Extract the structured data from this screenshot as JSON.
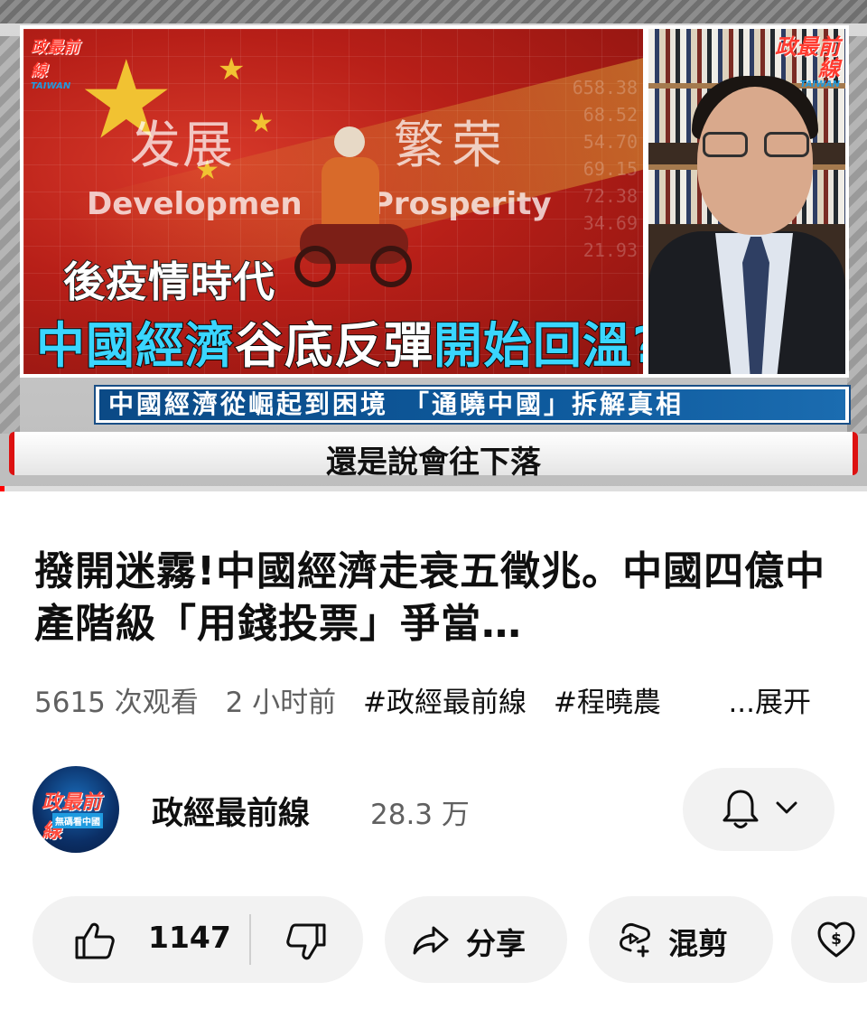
{
  "video": {
    "logo_left": {
      "line1": "政最前線",
      "line2": "TAIWAN"
    },
    "logo_right": {
      "line1": "政最前線",
      "line2": "TAIWAN"
    },
    "bg_text_cn_left": "发展",
    "bg_text_cn_right": "繁荣",
    "bg_text_en_left": "Developmen",
    "bg_text_en_right": "Prosperity",
    "headline_line1": "後疫情時代",
    "headline_line2": {
      "part1": "中國經濟",
      "part2": "谷底反彈",
      "part3": "開始回溫?"
    },
    "ticker": "中國經濟從崛起到困境　「通曉中國」拆解真相",
    "subtitle": "還是說會往下落",
    "progress_percent": 0.5,
    "colors": {
      "accent_red": "#ff0000",
      "headline_cyan": "#3ad6ff",
      "ticker_blue": "#0e5a9d"
    }
  },
  "info": {
    "title": "撥開迷霧!中國經濟走衰五徵兆。中國四億中產階級「用錢投票」爭當…",
    "views": "5615 次观看",
    "time": "2 小时前",
    "tags": [
      "#政經最前線",
      "#程曉農"
    ],
    "more_label": "...展开"
  },
  "channel": {
    "name": "政經最前線",
    "subscribers": "28.3 万",
    "avatar": {
      "line1": "政最前線",
      "line2": "無碼看中國"
    },
    "bell_icon": "bell-icon",
    "chevron_icon": "chevron-down-icon"
  },
  "actions": {
    "like_count": "1147",
    "share_label": "分享",
    "remix_label": "混剪",
    "icons": [
      "thumbs-up-icon",
      "thumbs-down-icon",
      "share-icon",
      "remix-icon",
      "thanks-icon"
    ]
  }
}
